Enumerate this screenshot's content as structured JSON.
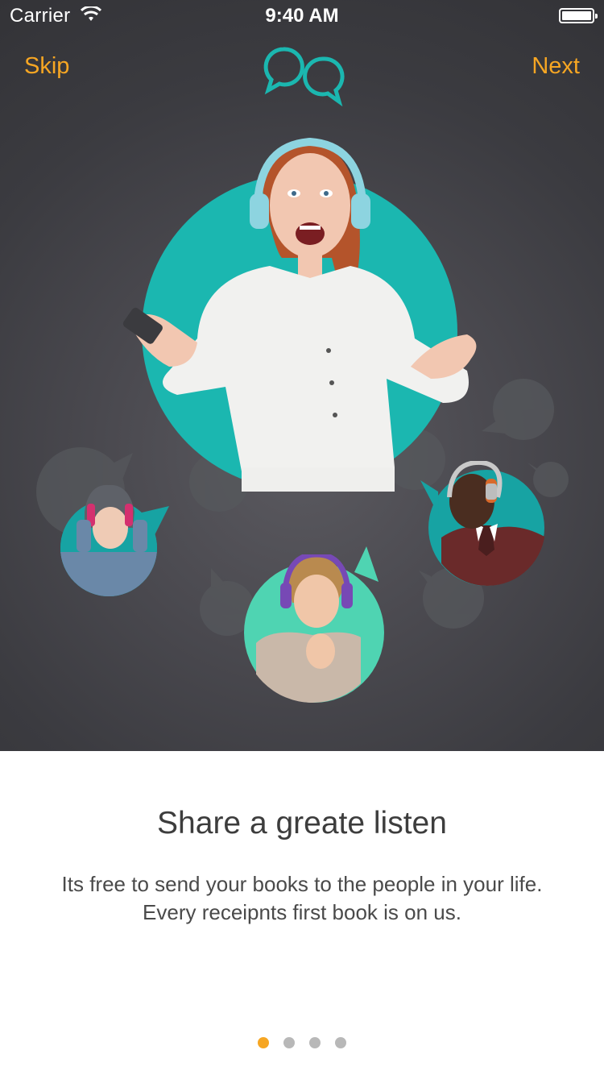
{
  "status_bar": {
    "carrier": "Carrier",
    "time": "9:40 AM"
  },
  "nav": {
    "skip_label": "Skip",
    "next_label": "Next",
    "logo_icon": "chat-bubbles-icon"
  },
  "colors": {
    "accent": "#f6a623",
    "teal": "#1bb7b0",
    "mint": "#4fd4b2",
    "hero_bg": "#45454a",
    "title_text": "#3d3d3d"
  },
  "hero": {
    "people": [
      {
        "name": "woman-red-hair-headphones",
        "icon": "person-photo"
      },
      {
        "name": "woman-beanie-headphones",
        "icon": "person-photo"
      },
      {
        "name": "woman-blonde-headphones",
        "icon": "person-photo"
      },
      {
        "name": "man-headphones",
        "icon": "person-photo"
      }
    ]
  },
  "content": {
    "title": "Share a greate listen",
    "description": "Its free to send your books to the people in your life. Every receipnts first book is on us."
  },
  "pagination": {
    "total": 4,
    "current": 1
  }
}
